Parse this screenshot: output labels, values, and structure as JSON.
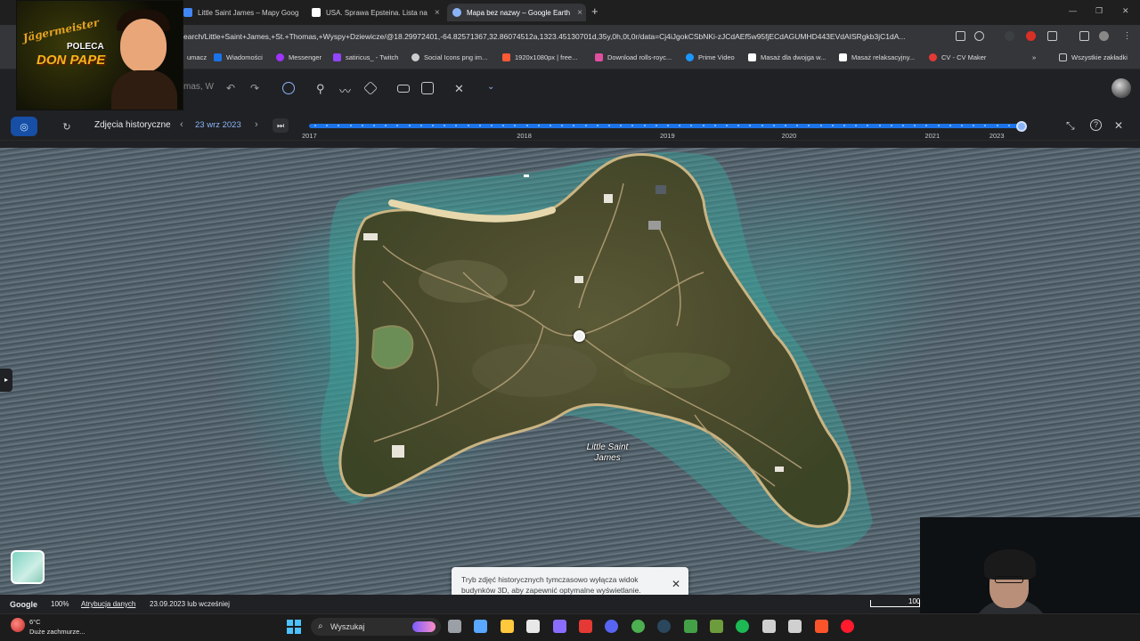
{
  "browser": {
    "tabs": [
      {
        "title": "Little Saint James – Mapy Goog",
        "active": false,
        "favicon_color": "#4285f4"
      },
      {
        "title": "USA. Sprawa Epsteina. Lista na",
        "active": false,
        "favicon_color": "#ffffff"
      },
      {
        "title": "Mapa bez nazwy – Google Earth",
        "active": true,
        "favicon_color": "#8ab4f8"
      }
    ],
    "tab_close": "×",
    "new_tab": "+",
    "window_controls": [
      "—",
      "❐",
      "✕"
    ],
    "url": "earch/Little+Saint+James,+St.+Thomas,+Wyspy+Dziewicze/@18.29972401,-64.82571367,32.86074512a,1323.45130701d,35y,0h,0t,0r/data=Cj4iJgokCSbNKi-zJCdAEf5w95fjECdAGUMHD443EVdAISRgkb3jC1dA..."
  },
  "bookmarks": [
    {
      "label": "umacz",
      "color": "#4285f4"
    },
    {
      "label": "Wiadomości",
      "color": "#1a73e8"
    },
    {
      "label": "Messenger",
      "color": "#a033ff"
    },
    {
      "label": "satiricus_ - Twitch",
      "color": "#9146ff"
    },
    {
      "label": "Social Icons png im...",
      "color": "#cccccc"
    },
    {
      "label": "1920x1080px | free...",
      "color": "#ff5a36"
    },
    {
      "label": "Download rolls-royc...",
      "color": "#e04fa0"
    },
    {
      "label": "Prime Video",
      "color": "#1a98ff"
    },
    {
      "label": "Masaż dla dwojga w...",
      "color": "#ffffff"
    },
    {
      "label": "Masaż relaksacyjny...",
      "color": "#ffffff"
    },
    {
      "label": "CV - CV Maker",
      "color": "#e53935"
    }
  ],
  "bookmarks_more": "»",
  "all_bookmarks": "Wszystkie zakładki",
  "overlay": {
    "brand": "Jägermeister",
    "line1": "POLECA",
    "line2": "DON PAPE"
  },
  "earth": {
    "search_fragment": "mas, W",
    "toolbar_icons": [
      "undo-icon",
      "redo-icon",
      "history-icon",
      "pin-icon",
      "path-icon",
      "layers-icon",
      "ruler-icon",
      "image-icon",
      "measure-icon",
      "chevron-down-icon"
    ]
  },
  "historical": {
    "label": "Zdjęcia historyczne",
    "date": "23 wrz 2023",
    "prev": "‹",
    "next": "›",
    "end": "⏭",
    "years": [
      {
        "label": "2017",
        "pos": 0.0
      },
      {
        "label": "2018",
        "pos": 0.3
      },
      {
        "label": "2019",
        "pos": 0.5
      },
      {
        "label": "2020",
        "pos": 0.67
      },
      {
        "label": "2021",
        "pos": 0.87
      },
      {
        "label": "2023",
        "pos": 0.96
      }
    ],
    "selected_pos": 0.995,
    "compress": "⤡",
    "help": "?",
    "close": "✕"
  },
  "map": {
    "place_line1": "Little Saint",
    "place_line2": "James",
    "side_handle": "▸"
  },
  "toast": {
    "text": "Tryb zdjęć historycznych tymczasowo wyłącza widok budynków 3D, aby zapewnić optymalne wyświetlanie.",
    "close": "✕"
  },
  "status": {
    "google": "Google",
    "zoom": "100%",
    "attribution": "Atrybucja danych",
    "imagery_date": "23.09.2023 lub wcześniej",
    "scale_label": "100"
  },
  "taskbar": {
    "temperature": "6°C",
    "weather": "Duże zachmurze...",
    "search": "Wyszukaj",
    "apps": [
      {
        "name": "file-icon",
        "color": "#9aa0a6"
      },
      {
        "name": "copilot-icon",
        "color": "#5aa7ff"
      },
      {
        "name": "folder-icon",
        "color": "#ffc83d"
      },
      {
        "name": "store-icon",
        "color": "#e8e8e8"
      },
      {
        "name": "app-icon",
        "color": "#8a6dff"
      },
      {
        "name": "l-app-icon",
        "color": "#e53935"
      },
      {
        "name": "discord-icon",
        "color": "#5865f2"
      },
      {
        "name": "chrome-icon",
        "color": "#4caf50"
      },
      {
        "name": "steam-icon",
        "color": "#2a475e"
      },
      {
        "name": "xbox-icon",
        "color": "#43a047"
      },
      {
        "name": "minecraft-icon",
        "color": "#6d9c3d"
      },
      {
        "name": "spotify-icon",
        "color": "#1db954"
      },
      {
        "name": "controller-icon",
        "color": "#cfcfcf"
      },
      {
        "name": "github-icon",
        "color": "#d0d0d0"
      },
      {
        "name": "brave-icon",
        "color": "#fb542b"
      },
      {
        "name": "opera-icon",
        "color": "#ff1b2d"
      }
    ]
  }
}
